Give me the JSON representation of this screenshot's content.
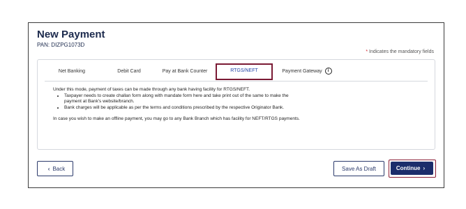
{
  "page": {
    "title": "New Payment",
    "pan": "PAN: DIZPG1073D",
    "mandatory_star": "*",
    "mandatory_note": "Indicates the mandatory fields"
  },
  "tabs": [
    {
      "label": "Net Banking",
      "active": false
    },
    {
      "label": "Debit Card",
      "active": false
    },
    {
      "label": "Pay at Bank Counter",
      "active": false
    },
    {
      "label": "RTGS/NEFT",
      "active": true
    },
    {
      "label": "Payment Gateway",
      "active": false
    }
  ],
  "content": {
    "intro": "Under this mode, payment of taxes can be made through any bank having facility for RTGS/NEFT.",
    "bullets": [
      "Taxpayer needs to create challan form along with mandate form here and take print out of the same to make the payment at Bank's website/branch.",
      "Bank charges will be applicable as per the terms and conditions prescribed by the respective Originator Bank."
    ],
    "offline_note": "In case you wish to make an offline payment, you may go to any Bank Branch which has facility for NEFT/RTGS payments."
  },
  "buttons": {
    "back": "Back",
    "save_draft": "Save As Draft",
    "continue": "Continue"
  },
  "icons": {
    "info": "info-icon",
    "back_chevron": "chevron-left-icon",
    "continue_chevron": "chevron-right-icon"
  },
  "colors": {
    "accent_dark_blue": "#1c2d6b",
    "active_tab_border": "#7a1a34",
    "mandatory_star": "#d2222d"
  }
}
